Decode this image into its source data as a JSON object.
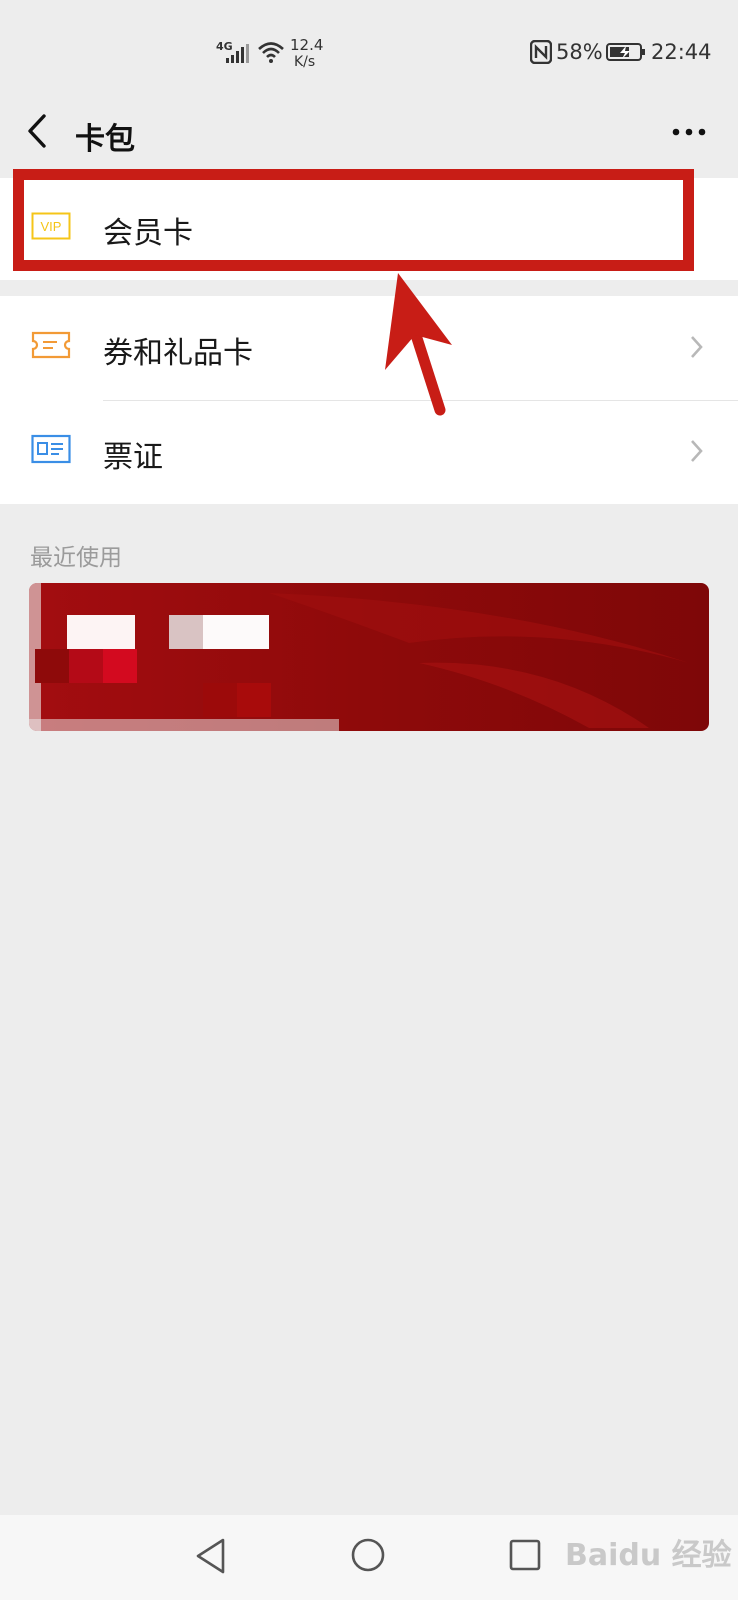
{
  "status_bar": {
    "network": "4G",
    "speed_value": "12.4",
    "speed_unit": "K/s",
    "battery": "58%",
    "time": "22:44"
  },
  "nav": {
    "title": "卡包"
  },
  "menu": {
    "items": [
      {
        "label": "会员卡",
        "icon": "vip-icon"
      },
      {
        "label": "券和礼品卡",
        "icon": "ticket-icon"
      },
      {
        "label": "票证",
        "icon": "id-card-icon"
      }
    ]
  },
  "recent": {
    "title": "最近使用"
  },
  "watermark": "Baidu 经验",
  "colors": {
    "vip": "#f5c518",
    "ticket": "#f29a36",
    "id_card": "#3a8ee6",
    "highlight": "#c81d16",
    "card_red": "#9b0b0b"
  }
}
